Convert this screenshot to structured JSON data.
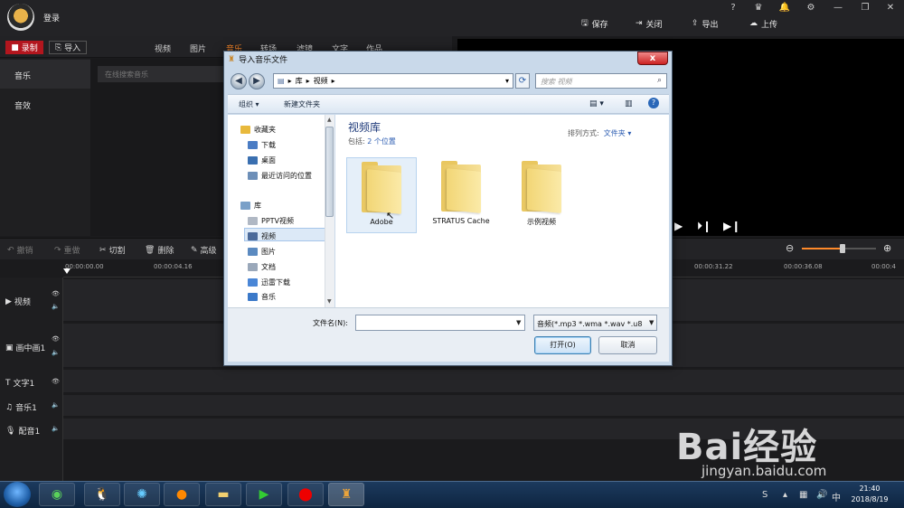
{
  "app": {
    "login_label": "登录",
    "top_actions": [
      {
        "label": "保存",
        "icon": "save-icon"
      },
      {
        "label": "关闭",
        "icon": "close-door-icon"
      },
      {
        "label": "导出",
        "icon": "export-icon"
      },
      {
        "label": "上传",
        "icon": "upload-icon"
      }
    ],
    "record_label": "录制",
    "import_label": "导入",
    "tabs": [
      "视频",
      "图片",
      "音乐",
      "转场",
      "滤镜",
      "文字",
      "作品"
    ],
    "active_tab": "音乐",
    "left_nav": [
      "音乐",
      "音效"
    ],
    "search_placeholder": "在线搜索音乐"
  },
  "editbar": {
    "undo": "撤销",
    "redo": "重做",
    "cut": "切割",
    "delete": "删除",
    "advanced": "高级",
    "zoom_level": 0.55
  },
  "timeline": {
    "ticks": [
      "00:00:00.00",
      "00:00:04.16",
      "00:00:31.22",
      "00:00:36.08",
      "00:00:4"
    ],
    "tracks": [
      {
        "label": "视频",
        "icon": "video-track-icon"
      },
      {
        "label": "画中画1",
        "icon": "pip-track-icon"
      },
      {
        "label": "文字1",
        "icon": "text-track-icon"
      },
      {
        "label": "音乐1",
        "icon": "music-track-icon"
      },
      {
        "label": "配音1",
        "icon": "mic-track-icon"
      }
    ]
  },
  "dialog": {
    "title": "导入音乐文件",
    "close": "x",
    "address": [
      "库",
      "视频"
    ],
    "search_placeholder": "搜索 视频",
    "organize": "组织 ▾",
    "new_folder": "新建文件夹",
    "tree": [
      {
        "label": "收藏夹",
        "color": "#e8b93c"
      },
      {
        "label": "下载",
        "color": "#4a7cc4"
      },
      {
        "label": "桌面",
        "color": "#3a6fb0"
      },
      {
        "label": "最近访问的位置",
        "color": "#6d8fb8"
      },
      {
        "label": "库",
        "color": "#7aa0c8"
      },
      {
        "label": "PPTV视频",
        "color": "#b0b8c4"
      },
      {
        "label": "视频",
        "color": "#4b6a9a"
      },
      {
        "label": "图片",
        "color": "#5b8ac0"
      },
      {
        "label": "文档",
        "color": "#9aa8ba"
      },
      {
        "label": "迅雷下载",
        "color": "#4a86d6"
      },
      {
        "label": "音乐",
        "color": "#3b79c9"
      }
    ],
    "library_title": "视频库",
    "library_sub_prefix": "包括:",
    "library_sub_link": "2 个位置",
    "sort_prefix": "排列方式:",
    "sort_value": "文件夹 ▾",
    "folders": [
      "Adobe",
      "STRATUS Cache",
      "示例视频"
    ],
    "filename_label": "文件名(N):",
    "filetype": "音频(*.mp3 *.wma *.wav *.u8",
    "open": "打开(O)",
    "cancel": "取消"
  },
  "taskbar": {
    "time": "21:40",
    "date": "2018/8/19"
  },
  "watermark": {
    "brand": "Bai经验",
    "url": "jingyan.baidu.com"
  }
}
